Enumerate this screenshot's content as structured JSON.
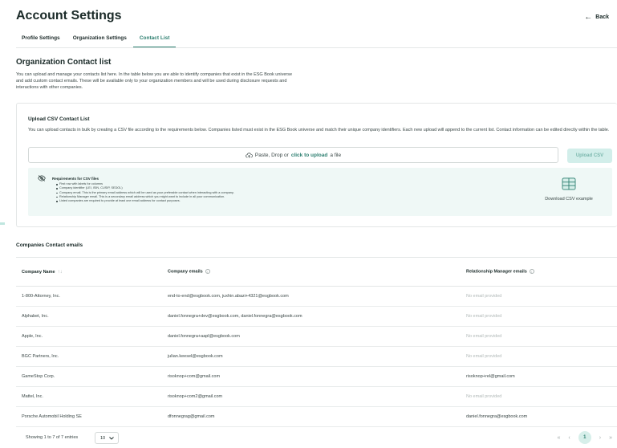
{
  "header": {
    "title": "Account Settings",
    "back_label": "Back"
  },
  "tabs": [
    {
      "label": "Profile Settings",
      "active": false
    },
    {
      "label": "Organization Settings",
      "active": false
    },
    {
      "label": "Contact List",
      "active": true
    }
  ],
  "intro": {
    "title": "Organization Contact list",
    "description": "You can upload and manage your contacts list here. In the table below you are able to identify companies that exist in the ESG Book universe and add custom contact emails. These will be available only to your organization members and will be used during disclosure requests and interactions with other companies."
  },
  "upload": {
    "title": "Upload CSV Contact List",
    "description": "You can upload contacts in bulk by creating a CSV file according to the requirements below. Companies listed must exist in the ESG Book universe and match their unique company identifiers. Each new upload will append to the current list. Contact information can be edited directly within the table.",
    "drop_prefix": "Paste, Drop or",
    "drop_link": "click to upload",
    "drop_suffix": "a file",
    "button_label": "Upload CSV",
    "requirements_title": "Requirements for CSV files",
    "requirements": [
      "First row with labels for columns",
      "Company identifier (LEI, ISIN, CUSIP, SEDOL)",
      "Company email. This is the primary email address which will be used as your preferable contact when interacting with a company.",
      "Relationship Manager email. This is a secondary email address which you might want to include in all your communication.",
      "Listed companies are required to provide at least one email address for contact purposes."
    ],
    "download_label": "Download CSV example"
  },
  "table": {
    "title": "Companies Contact emails",
    "columns": [
      "Company Name",
      "Company emails",
      "Relationship Manager emails"
    ],
    "rows": [
      {
        "company": "1-800-Attorney, Inc.",
        "emails": "end-to-end@esgbook.com, juxhin.abazi+4321@esgbook.com",
        "rm": "No email provided",
        "rm_empty": true
      },
      {
        "company": "Alphabet, Inc.",
        "emails": "daniel.fonnegra+dev@esgbook.com, daniel.fonnegra@esgbook.com",
        "rm": "No email provided",
        "rm_empty": true
      },
      {
        "company": "Apple, Inc.",
        "emails": "daniel.fonnegra+aapl@esgbook.com",
        "rm": "No email provided",
        "rm_empty": true
      },
      {
        "company": "BGC Partners, Inc.",
        "emails": "julian.keesel@esgbook.com",
        "rm": "No email provided",
        "rm_empty": true
      },
      {
        "company": "GameStop Corp.",
        "emails": "risoknop+com@gmail.com",
        "rm": "risoknop+rel@gmail.com",
        "rm_empty": false
      },
      {
        "company": "Mattel, Inc.",
        "emails": "risoknop+com2@gmail.com",
        "rm": "No email provided",
        "rm_empty": true
      },
      {
        "company": "Porsche Automobil Holding SE",
        "emails": "dfonnegrag@gmail.com",
        "rm": "daniel.fonnegra@esgbook.com",
        "rm_empty": false
      }
    ],
    "footer": {
      "showing": "Showing 1 to 7 of 7 entries",
      "per_page": "10",
      "current_page": "1"
    }
  },
  "colors": {
    "accent": "#2d7f70",
    "accent_light": "#d2eeea",
    "requirements_bg": "#eff8f6"
  },
  "icons": [
    "back-arrow-icon",
    "cloud-upload-icon",
    "eye-off-icon",
    "table-icon",
    "sort-icon",
    "info-icon",
    "chevron-down-icon",
    "double-chevron-left-icon",
    "chevron-left-icon",
    "chevron-right-icon",
    "double-chevron-right-icon"
  ]
}
